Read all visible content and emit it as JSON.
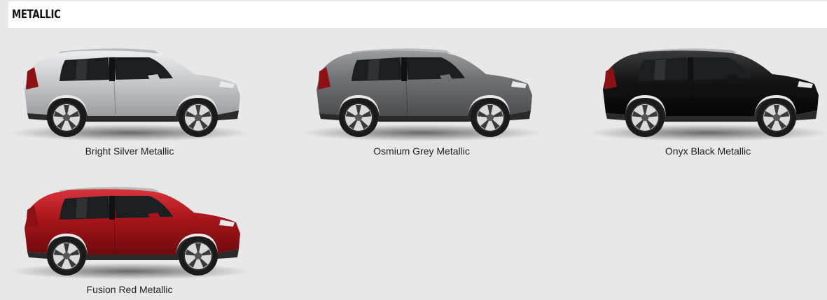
{
  "section": {
    "title": "METALLIC"
  },
  "swatches": [
    {
      "name": "Bright Silver Metallic",
      "body_color": "#c8cacd",
      "highlight": "#eceef0",
      "shade": "#9a9da1"
    },
    {
      "name": "Osmium Grey Metallic",
      "body_color": "#6e7073",
      "highlight": "#9a9c9f",
      "shade": "#4a4c4f"
    },
    {
      "name": "Onyx Black Metallic",
      "body_color": "#151516",
      "highlight": "#3a3b3d",
      "shade": "#050505"
    },
    {
      "name": "Fusion Red Metallic",
      "body_color": "#a8151a",
      "highlight": "#d8343a",
      "shade": "#6e0a0e"
    }
  ]
}
